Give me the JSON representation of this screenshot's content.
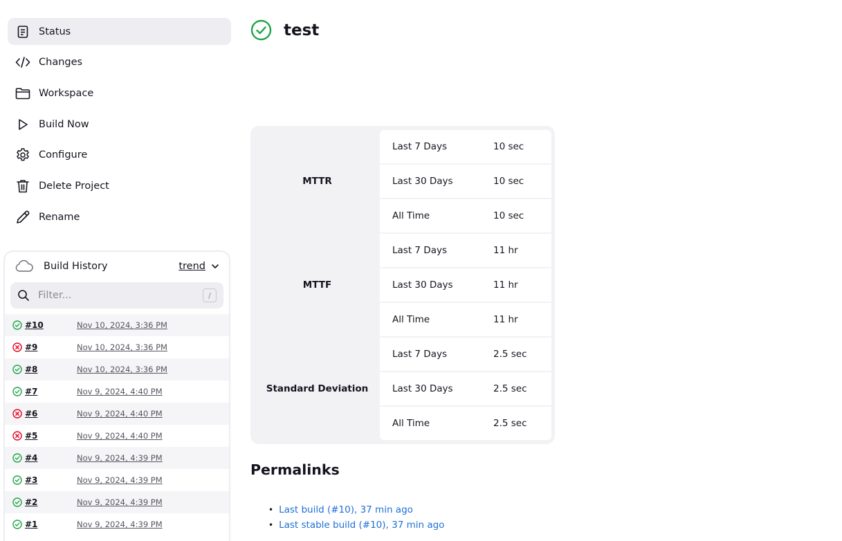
{
  "sidebar": {
    "items": [
      {
        "label": "Status",
        "icon": "document-icon",
        "active": true
      },
      {
        "label": "Changes",
        "icon": "code-icon"
      },
      {
        "label": "Workspace",
        "icon": "folder-icon"
      },
      {
        "label": "Build Now",
        "icon": "play-icon"
      },
      {
        "label": "Configure",
        "icon": "gear-icon"
      },
      {
        "label": "Delete Project",
        "icon": "trash-icon"
      },
      {
        "label": "Rename",
        "icon": "pencil-icon"
      }
    ]
  },
  "build_history": {
    "title": "Build History",
    "trend_label": "trend",
    "filter_placeholder": "Filter...",
    "filter_shortcut": "/",
    "builds": [
      {
        "number": "#10",
        "date": "Nov 10, 2024, 3:36 PM",
        "status": "success"
      },
      {
        "number": "#9",
        "date": "Nov 10, 2024, 3:36 PM",
        "status": "failed"
      },
      {
        "number": "#8",
        "date": "Nov 10, 2024, 3:36 PM",
        "status": "success"
      },
      {
        "number": "#7",
        "date": "Nov 9, 2024, 4:40 PM",
        "status": "success"
      },
      {
        "number": "#6",
        "date": "Nov 9, 2024, 4:40 PM",
        "status": "failed"
      },
      {
        "number": "#5",
        "date": "Nov 9, 2024, 4:40 PM",
        "status": "failed"
      },
      {
        "number": "#4",
        "date": "Nov 9, 2024, 4:39 PM",
        "status": "success"
      },
      {
        "number": "#3",
        "date": "Nov 9, 2024, 4:39 PM",
        "status": "success"
      },
      {
        "number": "#2",
        "date": "Nov 9, 2024, 4:39 PM",
        "status": "success"
      },
      {
        "number": "#1",
        "date": "Nov 9, 2024, 4:39 PM",
        "status": "success"
      }
    ]
  },
  "project": {
    "title": "test",
    "status": "success"
  },
  "stats": {
    "groups": [
      {
        "name": "MTTR",
        "rows": [
          {
            "period": "Last 7 Days",
            "value": "10 sec"
          },
          {
            "period": "Last 30 Days",
            "value": "10 sec"
          },
          {
            "period": "All Time",
            "value": "10 sec"
          }
        ]
      },
      {
        "name": "MTTF",
        "rows": [
          {
            "period": "Last 7 Days",
            "value": "11 hr"
          },
          {
            "period": "Last 30 Days",
            "value": "11 hr"
          },
          {
            "period": "All Time",
            "value": "11 hr"
          }
        ]
      },
      {
        "name": "Standard Deviation",
        "rows": [
          {
            "period": "Last 7 Days",
            "value": "2.5 sec"
          },
          {
            "period": "Last 30 Days",
            "value": "2.5 sec"
          },
          {
            "period": "All Time",
            "value": "2.5 sec"
          }
        ]
      }
    ]
  },
  "permalinks": {
    "heading": "Permalinks",
    "links": [
      "Last build (#10), 37 min ago",
      "Last stable build (#10), 37 min ago"
    ]
  },
  "colors": {
    "success": "#1ea446",
    "failed": "#e6001f",
    "link": "#1f6fd6",
    "panel": "#f2f2f5"
  }
}
